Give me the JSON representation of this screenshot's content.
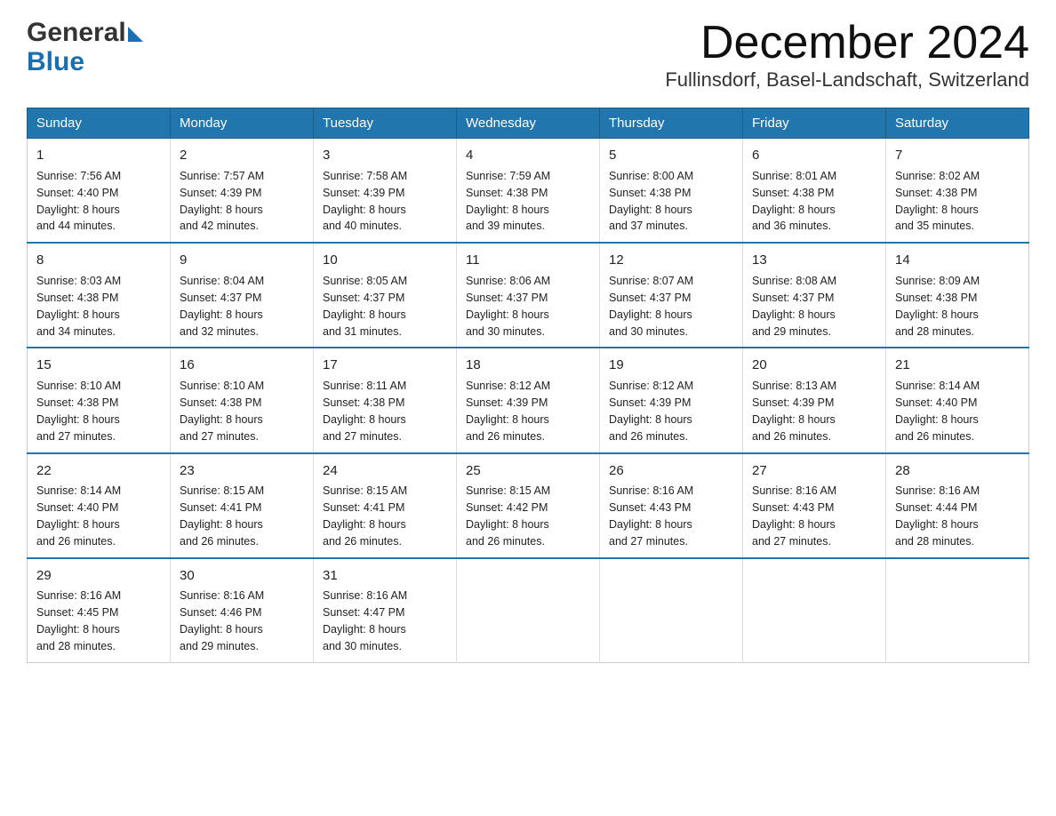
{
  "header": {
    "month_title": "December 2024",
    "location": "Fullinsdorf, Basel-Landschaft, Switzerland",
    "logo_general": "General",
    "logo_blue": "Blue"
  },
  "days_of_week": [
    "Sunday",
    "Monday",
    "Tuesday",
    "Wednesday",
    "Thursday",
    "Friday",
    "Saturday"
  ],
  "weeks": [
    [
      {
        "day": "1",
        "sunrise": "7:56 AM",
        "sunset": "4:40 PM",
        "daylight": "8 hours and 44 minutes."
      },
      {
        "day": "2",
        "sunrise": "7:57 AM",
        "sunset": "4:39 PM",
        "daylight": "8 hours and 42 minutes."
      },
      {
        "day": "3",
        "sunrise": "7:58 AM",
        "sunset": "4:39 PM",
        "daylight": "8 hours and 40 minutes."
      },
      {
        "day": "4",
        "sunrise": "7:59 AM",
        "sunset": "4:38 PM",
        "daylight": "8 hours and 39 minutes."
      },
      {
        "day": "5",
        "sunrise": "8:00 AM",
        "sunset": "4:38 PM",
        "daylight": "8 hours and 37 minutes."
      },
      {
        "day": "6",
        "sunrise": "8:01 AM",
        "sunset": "4:38 PM",
        "daylight": "8 hours and 36 minutes."
      },
      {
        "day": "7",
        "sunrise": "8:02 AM",
        "sunset": "4:38 PM",
        "daylight": "8 hours and 35 minutes."
      }
    ],
    [
      {
        "day": "8",
        "sunrise": "8:03 AM",
        "sunset": "4:38 PM",
        "daylight": "8 hours and 34 minutes."
      },
      {
        "day": "9",
        "sunrise": "8:04 AM",
        "sunset": "4:37 PM",
        "daylight": "8 hours and 32 minutes."
      },
      {
        "day": "10",
        "sunrise": "8:05 AM",
        "sunset": "4:37 PM",
        "daylight": "8 hours and 31 minutes."
      },
      {
        "day": "11",
        "sunrise": "8:06 AM",
        "sunset": "4:37 PM",
        "daylight": "8 hours and 30 minutes."
      },
      {
        "day": "12",
        "sunrise": "8:07 AM",
        "sunset": "4:37 PM",
        "daylight": "8 hours and 30 minutes."
      },
      {
        "day": "13",
        "sunrise": "8:08 AM",
        "sunset": "4:37 PM",
        "daylight": "8 hours and 29 minutes."
      },
      {
        "day": "14",
        "sunrise": "8:09 AM",
        "sunset": "4:38 PM",
        "daylight": "8 hours and 28 minutes."
      }
    ],
    [
      {
        "day": "15",
        "sunrise": "8:10 AM",
        "sunset": "4:38 PM",
        "daylight": "8 hours and 27 minutes."
      },
      {
        "day": "16",
        "sunrise": "8:10 AM",
        "sunset": "4:38 PM",
        "daylight": "8 hours and 27 minutes."
      },
      {
        "day": "17",
        "sunrise": "8:11 AM",
        "sunset": "4:38 PM",
        "daylight": "8 hours and 27 minutes."
      },
      {
        "day": "18",
        "sunrise": "8:12 AM",
        "sunset": "4:39 PM",
        "daylight": "8 hours and 26 minutes."
      },
      {
        "day": "19",
        "sunrise": "8:12 AM",
        "sunset": "4:39 PM",
        "daylight": "8 hours and 26 minutes."
      },
      {
        "day": "20",
        "sunrise": "8:13 AM",
        "sunset": "4:39 PM",
        "daylight": "8 hours and 26 minutes."
      },
      {
        "day": "21",
        "sunrise": "8:14 AM",
        "sunset": "4:40 PM",
        "daylight": "8 hours and 26 minutes."
      }
    ],
    [
      {
        "day": "22",
        "sunrise": "8:14 AM",
        "sunset": "4:40 PM",
        "daylight": "8 hours and 26 minutes."
      },
      {
        "day": "23",
        "sunrise": "8:15 AM",
        "sunset": "4:41 PM",
        "daylight": "8 hours and 26 minutes."
      },
      {
        "day": "24",
        "sunrise": "8:15 AM",
        "sunset": "4:41 PM",
        "daylight": "8 hours and 26 minutes."
      },
      {
        "day": "25",
        "sunrise": "8:15 AM",
        "sunset": "4:42 PM",
        "daylight": "8 hours and 26 minutes."
      },
      {
        "day": "26",
        "sunrise": "8:16 AM",
        "sunset": "4:43 PM",
        "daylight": "8 hours and 27 minutes."
      },
      {
        "day": "27",
        "sunrise": "8:16 AM",
        "sunset": "4:43 PM",
        "daylight": "8 hours and 27 minutes."
      },
      {
        "day": "28",
        "sunrise": "8:16 AM",
        "sunset": "4:44 PM",
        "daylight": "8 hours and 28 minutes."
      }
    ],
    [
      {
        "day": "29",
        "sunrise": "8:16 AM",
        "sunset": "4:45 PM",
        "daylight": "8 hours and 28 minutes."
      },
      {
        "day": "30",
        "sunrise": "8:16 AM",
        "sunset": "4:46 PM",
        "daylight": "8 hours and 29 minutes."
      },
      {
        "day": "31",
        "sunrise": "8:16 AM",
        "sunset": "4:47 PM",
        "daylight": "8 hours and 30 minutes."
      },
      {
        "day": "",
        "sunrise": "",
        "sunset": "",
        "daylight": ""
      },
      {
        "day": "",
        "sunrise": "",
        "sunset": "",
        "daylight": ""
      },
      {
        "day": "",
        "sunrise": "",
        "sunset": "",
        "daylight": ""
      },
      {
        "day": "",
        "sunrise": "",
        "sunset": "",
        "daylight": ""
      }
    ]
  ],
  "labels": {
    "sunrise": "Sunrise:",
    "sunset": "Sunset:",
    "daylight": "Daylight:"
  }
}
